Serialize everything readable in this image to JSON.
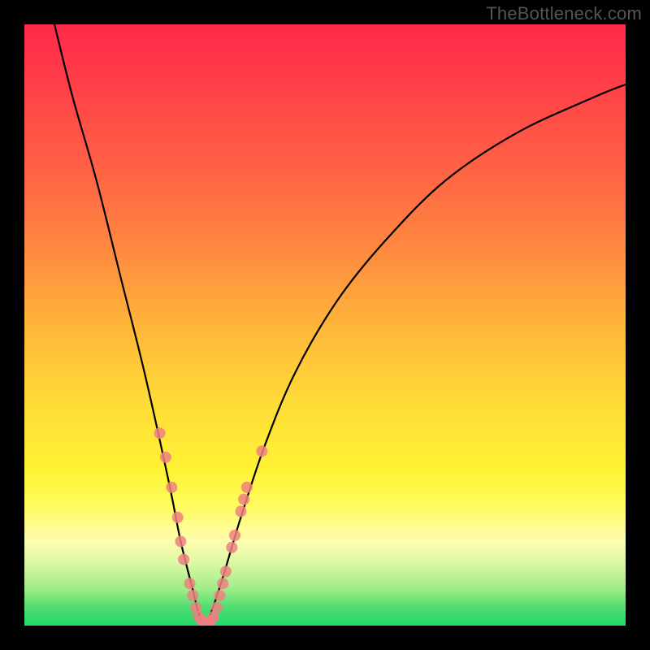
{
  "watermark": "TheBottleneck.com",
  "chart_data": {
    "type": "line",
    "title": "",
    "xlabel": "",
    "ylabel": "",
    "xlim": [
      0,
      100
    ],
    "ylim": [
      0,
      100
    ],
    "grid": false,
    "legend": false,
    "series": [
      {
        "name": "bottleneck-curve",
        "x": [
          5,
          8,
          12,
          16,
          20,
          24,
          26,
          28,
          29,
          30,
          31,
          33,
          36,
          40,
          45,
          52,
          60,
          70,
          82,
          95,
          100
        ],
        "y": [
          100,
          88,
          74,
          58,
          42,
          24,
          14,
          6,
          2,
          0,
          2,
          8,
          18,
          30,
          42,
          54,
          64,
          74,
          82,
          88,
          90
        ]
      }
    ],
    "scatter_points": {
      "name": "sample-points",
      "color": "#f08080",
      "points": [
        {
          "x": 22.5,
          "y": 32
        },
        {
          "x": 23.5,
          "y": 28
        },
        {
          "x": 24.5,
          "y": 23
        },
        {
          "x": 25.5,
          "y": 18
        },
        {
          "x": 26,
          "y": 14
        },
        {
          "x": 26.5,
          "y": 11
        },
        {
          "x": 27.5,
          "y": 7
        },
        {
          "x": 28,
          "y": 5
        },
        {
          "x": 28.5,
          "y": 3
        },
        {
          "x": 29,
          "y": 1.5
        },
        {
          "x": 29.5,
          "y": 0.8
        },
        {
          "x": 30,
          "y": 0.5
        },
        {
          "x": 30.5,
          "y": 0.5
        },
        {
          "x": 31,
          "y": 0.8
        },
        {
          "x": 31.5,
          "y": 1.5
        },
        {
          "x": 32,
          "y": 3
        },
        {
          "x": 32.5,
          "y": 5
        },
        {
          "x": 33,
          "y": 7
        },
        {
          "x": 33.5,
          "y": 9
        },
        {
          "x": 34.5,
          "y": 13
        },
        {
          "x": 35,
          "y": 15
        },
        {
          "x": 36,
          "y": 19
        },
        {
          "x": 36.5,
          "y": 21
        },
        {
          "x": 37,
          "y": 23
        },
        {
          "x": 39.5,
          "y": 29
        }
      ]
    },
    "background": {
      "type": "vertical-gradient",
      "stops": [
        {
          "pos": 0,
          "color": "#ff2a49"
        },
        {
          "pos": 50,
          "color": "#ffd937"
        },
        {
          "pos": 80,
          "color": "#fffb5d"
        },
        {
          "pos": 100,
          "color": "#23d96a"
        }
      ]
    }
  }
}
